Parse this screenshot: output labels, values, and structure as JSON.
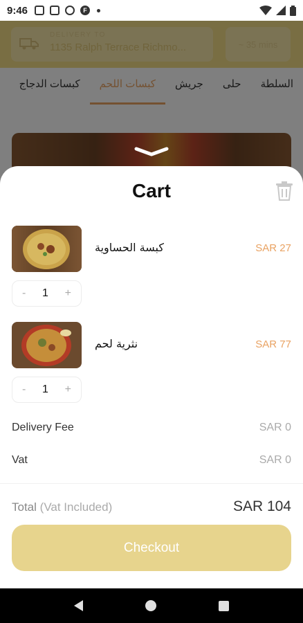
{
  "status_bar": {
    "time": "9:46",
    "icons": [
      "sim-icon",
      "photo-icon",
      "navigation-icon",
      "circle-icon",
      "f-app-icon"
    ],
    "right_icons": [
      "wifi-icon",
      "signal-icon",
      "battery-icon"
    ]
  },
  "header": {
    "delivery_label": "DELIVERY TO",
    "address": "1135 Ralph Terrace Richmo...",
    "eta": "~ 35 mins"
  },
  "category_tabs": [
    {
      "label": "السلطة",
      "active": false
    },
    {
      "label": "حلى",
      "active": false
    },
    {
      "label": "جريش",
      "active": false
    },
    {
      "label": "كبسات اللحم",
      "active": true
    },
    {
      "label": "كبسات الدجاج",
      "active": false
    }
  ],
  "cart": {
    "title": "Cart",
    "items": [
      {
        "name": "كبسة الحساوية",
        "price": "SAR 27",
        "quantity": "1",
        "minus": "-",
        "plus": "+"
      },
      {
        "name": "نثرية لحم",
        "price": "SAR 77",
        "quantity": "1",
        "minus": "-",
        "plus": "+"
      }
    ],
    "delivery_fee_label": "Delivery Fee",
    "delivery_fee_value": "SAR 0",
    "vat_label": "Vat",
    "vat_value": "SAR 0",
    "total_label": "Total",
    "total_sublabel": "(Vat Included)",
    "total_value": "SAR 104",
    "checkout_label": "Checkout"
  },
  "colors": {
    "accent_orange": "#e9a262",
    "header_yellow": "#f3dd86",
    "checkout_bg": "#e7d48d"
  }
}
